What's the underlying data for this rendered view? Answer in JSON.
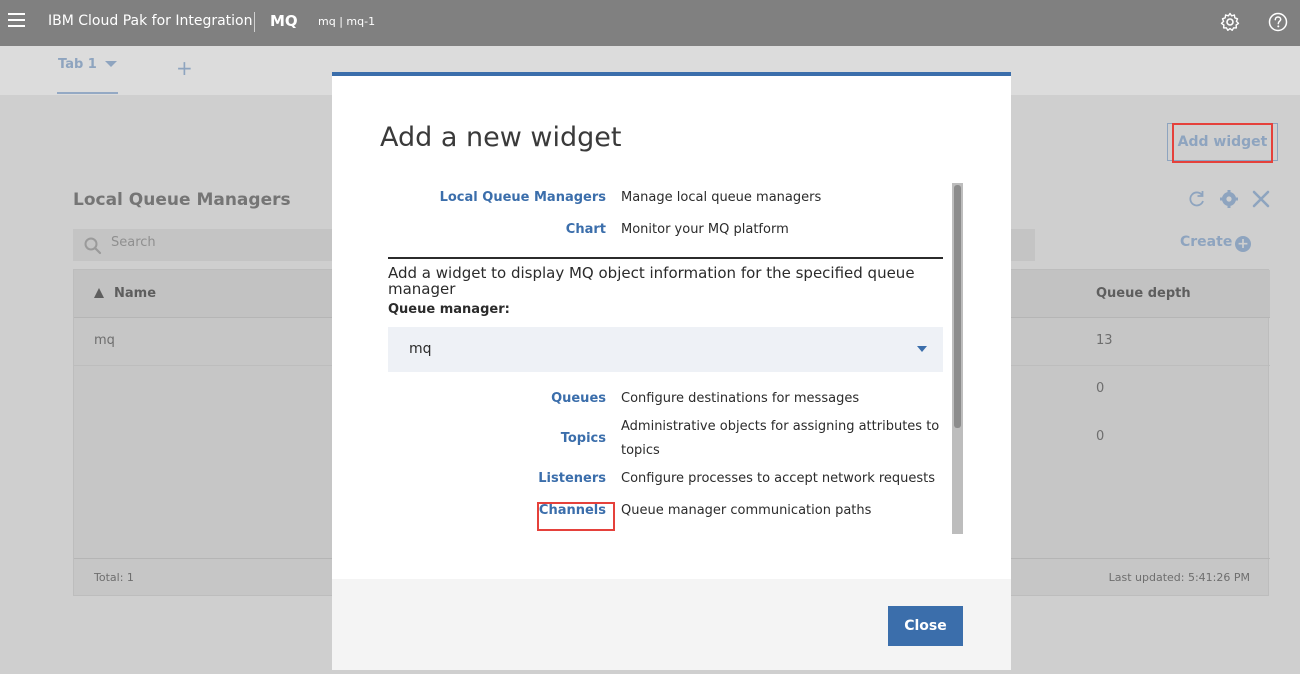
{
  "topbar": {
    "product_name": "IBM Cloud Pak for Integration",
    "app_name": "MQ",
    "instance": "mq | mq-1",
    "icons": [
      "menu-icon",
      "settings-icon",
      "help-icon"
    ]
  },
  "tabs": {
    "items": [
      {
        "label": "Tab 1"
      }
    ],
    "add_label": "+"
  },
  "toolbar": {
    "add_widget_label": "Add widget"
  },
  "widget": {
    "title": "Local Queue Managers",
    "icons": [
      "refresh-icon",
      "settings-icon",
      "close-icon"
    ],
    "search_placeholder": "Search",
    "create_label": "Create",
    "table": {
      "columns": [
        "Name",
        "Queue depth"
      ],
      "sort_column": "Name",
      "rows": [
        {
          "name": "mq",
          "queue_depth": "13"
        },
        {
          "name": "",
          "queue_depth": "0"
        },
        {
          "name": "",
          "queue_depth": "0"
        }
      ],
      "total": "Total: 1",
      "last_updated": "Last updated: 5:41:26 PM"
    }
  },
  "modal": {
    "title": "Add a new widget",
    "general_widgets": [
      {
        "label": "Local Queue Managers",
        "description": "Manage local queue managers"
      },
      {
        "label": "Chart",
        "description": "Monitor your MQ platform"
      }
    ],
    "section_text": "Add a widget to display MQ object information for the specified queue manager",
    "qm_label": "Queue manager:",
    "qm_value": "mq",
    "object_widgets": [
      {
        "label": "Queues",
        "description": "Configure destinations for messages"
      },
      {
        "label": "Topics",
        "description": "Administrative objects for assigning attributes to topics"
      },
      {
        "label": "Listeners",
        "description": "Configure processes to accept network requests"
      },
      {
        "label": "Channels",
        "description": "Queue manager communication paths"
      }
    ],
    "close_label": "Close"
  },
  "colors": {
    "accent": "#3b6eab",
    "highlight": "#e5413b",
    "topbar": "#808080"
  }
}
